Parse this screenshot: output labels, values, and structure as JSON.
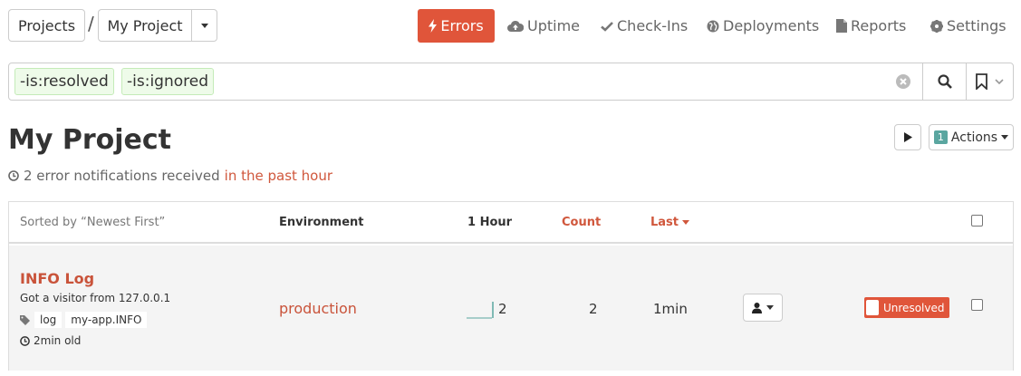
{
  "breadcrumb": {
    "projects_label": "Projects",
    "separator": "/",
    "current_project": "My Project"
  },
  "nav": {
    "errors": "Errors",
    "uptime": "Uptime",
    "checkins": "Check-Ins",
    "deployments": "Deployments",
    "reports": "Reports",
    "settings": "Settings",
    "active": "errors",
    "active_color": "#e0553a"
  },
  "search": {
    "filters": [
      "-is:resolved",
      "-is:ignored"
    ],
    "icons": [
      "clear-icon",
      "search-icon",
      "bookmark-icon",
      "chevron-down-icon"
    ]
  },
  "header": {
    "title": "My Project",
    "summary_prefix": "2 error notifications received",
    "summary_highlight": "in the past hour",
    "actions_count": "1",
    "actions_label": "Actions"
  },
  "table": {
    "sort_label": "Sorted by “Newest First”",
    "columns": {
      "environment": "Environment",
      "hour": "1 Hour",
      "count": "Count",
      "last": "Last"
    },
    "rows": [
      {
        "title": "INFO Log",
        "message": "Got a visitor from 127.0.0.1",
        "tags": [
          "log",
          "my-app.INFO"
        ],
        "age": "2min old",
        "environment": "production",
        "hour_count": "2",
        "count": "2",
        "last": "1min",
        "status": "Unresolved"
      }
    ]
  },
  "colors": {
    "accent": "#e0553a",
    "link": "#c9533a",
    "filter_bg": "#eefbe9",
    "badge": "#5aa6a0"
  }
}
